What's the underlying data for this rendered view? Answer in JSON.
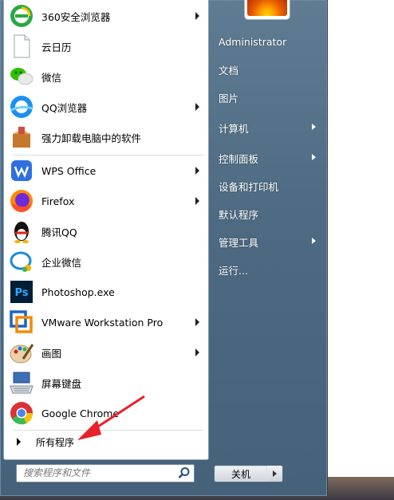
{
  "programs": [
    {
      "label": "360安全浏览器",
      "icon": "360-browser-icon",
      "submenu": true
    },
    {
      "label": "云日历",
      "icon": "blank-file-icon",
      "submenu": false
    },
    {
      "label": "微信",
      "icon": "wechat-icon",
      "submenu": false
    },
    {
      "label": "QQ浏览器",
      "icon": "qq-browser-icon",
      "submenu": true
    },
    {
      "label": "强力卸载电脑中的软件",
      "icon": "uninstall-box-icon",
      "submenu": false
    },
    {
      "label": "WPS Office",
      "icon": "wps-icon",
      "submenu": true
    },
    {
      "label": "Firefox",
      "icon": "firefox-icon",
      "submenu": true
    },
    {
      "label": "腾讯QQ",
      "icon": "qq-penguin-icon",
      "submenu": false
    },
    {
      "label": "企业微信",
      "icon": "wecom-icon",
      "submenu": false
    },
    {
      "label": "Photoshop.exe",
      "icon": "photoshop-icon",
      "submenu": false
    },
    {
      "label": "VMware Workstation Pro",
      "icon": "vmware-icon",
      "submenu": true
    },
    {
      "label": "画图",
      "icon": "paint-icon",
      "submenu": true
    },
    {
      "label": "屏幕键盘",
      "icon": "keyboard-icon",
      "submenu": false
    },
    {
      "label": "Google Chrome",
      "icon": "chrome-icon",
      "submenu": false
    }
  ],
  "all_programs_label": "所有程序",
  "search": {
    "placeholder": "搜索程序和文件"
  },
  "right_items": [
    {
      "label": "Administrator",
      "submenu": false
    },
    {
      "label": "文档",
      "submenu": false
    },
    {
      "label": "图片",
      "submenu": false
    },
    {
      "label": "计算机",
      "submenu": true
    },
    {
      "label": "控制面板",
      "submenu": true
    },
    {
      "label": "设备和打印机",
      "submenu": false
    },
    {
      "label": "默认程序",
      "submenu": false
    },
    {
      "label": "管理工具",
      "submenu": true
    },
    {
      "label": "运行...",
      "submenu": false
    }
  ],
  "shutdown_label": "关机",
  "colors": {
    "annotation_arrow": "#e8202a",
    "panel": "#4d6a82"
  }
}
